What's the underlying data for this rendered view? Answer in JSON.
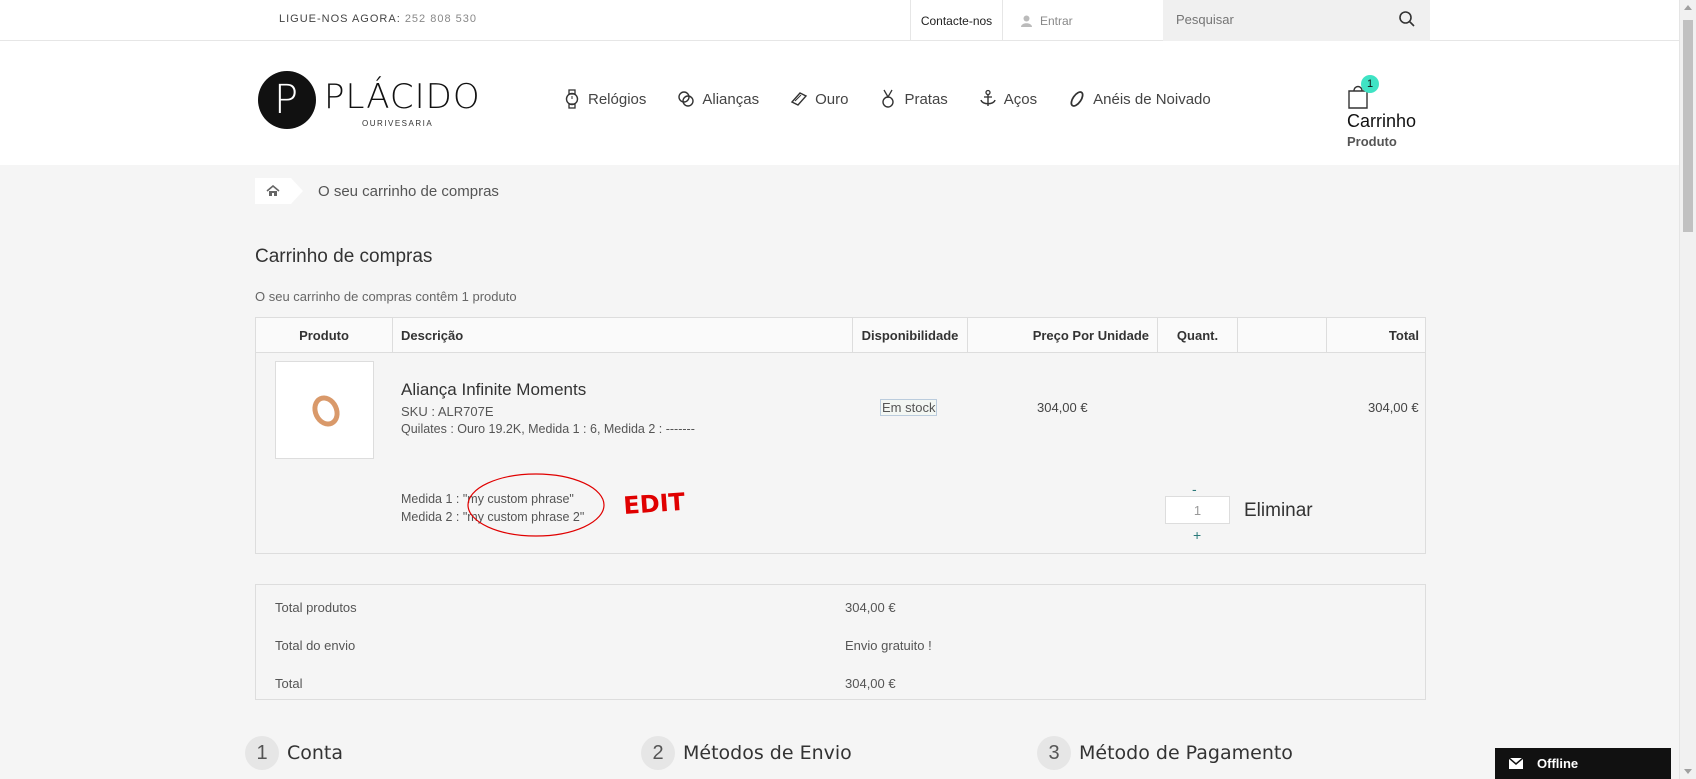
{
  "topbar": {
    "callus_label": "LIGUE-NOS AGORA:",
    "callus_number": "252 808 530",
    "contact": "Contacte-nos",
    "login": "Entrar",
    "search_placeholder": "Pesquisar"
  },
  "header": {
    "logo_initial": "P",
    "logo_name": "PLÁCIDO",
    "logo_sub": "OURIVESARIA",
    "nav": [
      {
        "label": "Relógios",
        "icon": "watch-icon"
      },
      {
        "label": "Alianças",
        "icon": "rings-icon"
      },
      {
        "label": "Ouro",
        "icon": "gold-bar-icon"
      },
      {
        "label": "Pratas",
        "icon": "medal-icon"
      },
      {
        "label": "Aços",
        "icon": "anchor-icon"
      },
      {
        "label": "Anéis de Noivado",
        "icon": "engagement-ring-icon"
      }
    ],
    "cart": {
      "count": "1",
      "label": "Carrinho",
      "sub": "Produto"
    }
  },
  "breadcrumb": {
    "current": "O seu carrinho de compras"
  },
  "page": {
    "title": "Carrinho de compras",
    "summary": "O seu carrinho de compras contêm 1 produto"
  },
  "table": {
    "headers": {
      "product": "Produto",
      "description": "Descrição",
      "availability": "Disponibilidade",
      "unit_price": "Preço Por Unidade",
      "qty": "Quant.",
      "total": "Total"
    },
    "row": {
      "name": "Aliança Infinite Moments",
      "sku": "SKU : ALR707E",
      "attributes": "Quilates : Ouro 19.2K, Medida 1 : 6, Medida 2 : -------",
      "availability": "Em stock",
      "unit_price": "304,00 €",
      "total": "304,00 €",
      "custom1": "Medida 1 : \"my custom phrase\"",
      "custom2": "Medida 2 : \"my custom phrase 2\"",
      "qty": "1",
      "minus": "-",
      "plus": "+",
      "remove": "Eliminar"
    },
    "annotation": "EDIT"
  },
  "totals": [
    {
      "label": "Total produtos",
      "value": "304,00 €"
    },
    {
      "label": "Total do envio",
      "value": "Envio gratuito !"
    },
    {
      "label": "Total",
      "value": "304,00 €"
    }
  ],
  "steps": [
    {
      "n": "1",
      "label": "Conta"
    },
    {
      "n": "2",
      "label": "Métodos de Envio"
    },
    {
      "n": "3",
      "label": "Método de Pagamento"
    }
  ],
  "chat": {
    "label": "Offline"
  },
  "colors": {
    "accent": "#3fe3c4",
    "annotation": "#e00000"
  }
}
